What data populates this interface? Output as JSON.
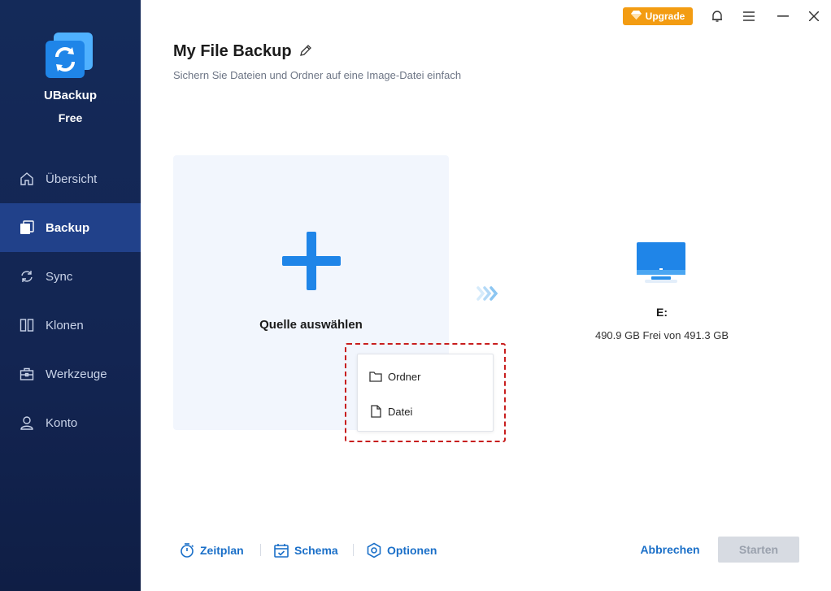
{
  "app": {
    "name": "UBackup",
    "edition": "Free"
  },
  "sidebar": {
    "items": [
      {
        "label": "Übersicht",
        "icon": "home-icon",
        "active": false
      },
      {
        "label": "Backup",
        "icon": "backup-icon",
        "active": true
      },
      {
        "label": "Sync",
        "icon": "sync-icon",
        "active": false
      },
      {
        "label": "Klonen",
        "icon": "clone-icon",
        "active": false
      },
      {
        "label": "Werkzeuge",
        "icon": "toolbox-icon",
        "active": false
      },
      {
        "label": "Konto",
        "icon": "user-icon",
        "active": false
      }
    ]
  },
  "titlebar": {
    "upgrade_label": "Upgrade"
  },
  "main": {
    "title": "My File Backup",
    "subtitle": "Sichern Sie Dateien und Ordner auf eine Image-Datei einfach",
    "source_label": "Quelle auswählen",
    "source_menu": [
      {
        "label": "Ordner",
        "icon": "folder-icon"
      },
      {
        "label": "Datei",
        "icon": "file-icon"
      }
    ],
    "destination": {
      "drive": "E:",
      "space": "490.9 GB Frei von 491.3 GB"
    }
  },
  "footer": {
    "schedule_label": "Zeitplan",
    "scheme_label": "Schema",
    "options_label": "Optionen",
    "cancel_label": "Abbrechen",
    "start_label": "Starten"
  },
  "colors": {
    "sidebar_bg": "#142a59",
    "sidebar_active": "#21418a",
    "accent_blue": "#1f85e8",
    "link_blue": "#1a6fc8",
    "upgrade_orange": "#f39c12",
    "highlight_red": "#c81e1e"
  }
}
